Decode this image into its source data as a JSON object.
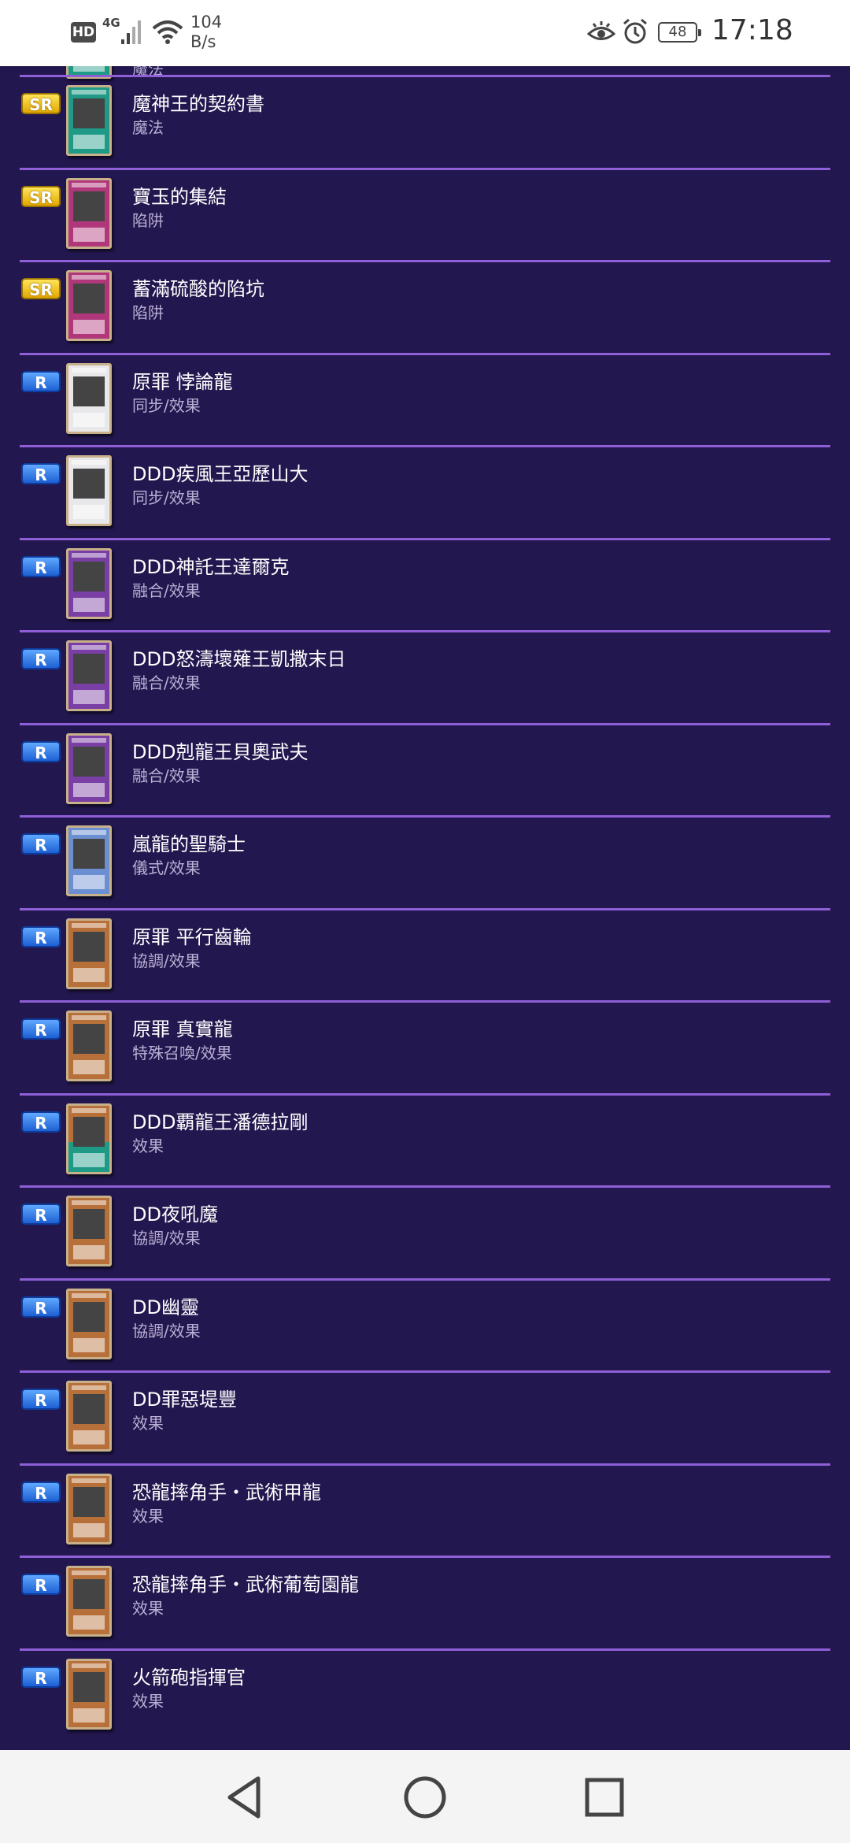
{
  "status_bar": {
    "hd": "HD",
    "network": "4G",
    "speed_value": "104",
    "speed_unit": "B/s",
    "battery": "48",
    "time": "17:18"
  },
  "partial_row": {
    "type": "魔法"
  },
  "cards": [
    {
      "rarity": "SR",
      "thumb": "spell",
      "name": "魔神王的契約書",
      "type": "魔法"
    },
    {
      "rarity": "SR",
      "thumb": "trap",
      "name": "寶玉的集結",
      "type": "陷阱"
    },
    {
      "rarity": "SR",
      "thumb": "trap",
      "name": "蓄滿硫酸的陷坑",
      "type": "陷阱"
    },
    {
      "rarity": "R",
      "thumb": "synchro",
      "name": "原罪 悖論龍",
      "type": "同步/效果"
    },
    {
      "rarity": "R",
      "thumb": "synchro",
      "name": "DDD疾風王亞歷山大",
      "type": "同步/效果"
    },
    {
      "rarity": "R",
      "thumb": "fusion",
      "name": "DDD神託王達爾克",
      "type": "融合/效果"
    },
    {
      "rarity": "R",
      "thumb": "fusion",
      "name": "DDD怒濤壞薙王凱撒末日",
      "type": "融合/效果"
    },
    {
      "rarity": "R",
      "thumb": "fusion",
      "name": "DDD剋龍王貝奧武夫",
      "type": "融合/效果"
    },
    {
      "rarity": "R",
      "thumb": "ritual",
      "name": "嵐龍的聖騎士",
      "type": "儀式/效果"
    },
    {
      "rarity": "R",
      "thumb": "effect",
      "name": "原罪 平行齒輪",
      "type": "協調/效果"
    },
    {
      "rarity": "R",
      "thumb": "effect",
      "name": "原罪 真實龍",
      "type": "特殊召喚/效果"
    },
    {
      "rarity": "R",
      "thumb": "pendeffect",
      "name": "DDD覇龍王潘德拉剛",
      "type": "效果"
    },
    {
      "rarity": "R",
      "thumb": "effect",
      "name": "DD夜吼魔",
      "type": "協調/效果"
    },
    {
      "rarity": "R",
      "thumb": "effect",
      "name": "DD幽靈",
      "type": "協調/效果"
    },
    {
      "rarity": "R",
      "thumb": "effect",
      "name": "DD罪惡堤豐",
      "type": "效果"
    },
    {
      "rarity": "R",
      "thumb": "effect",
      "name": "恐龍摔角手・武術甲龍",
      "type": "效果"
    },
    {
      "rarity": "R",
      "thumb": "effect",
      "name": "恐龍摔角手・武術葡萄園龍",
      "type": "效果"
    },
    {
      "rarity": "R",
      "thumb": "effect",
      "name": "火箭砲指揮官",
      "type": "效果"
    }
  ],
  "colors": {
    "background": "#23174f",
    "divider": "#8e5fd6",
    "sr_badge": "#f2c31a",
    "r_badge": "#2f7cf0"
  },
  "nav": {
    "back_icon": "back-triangle-icon",
    "home_icon": "home-circle-icon",
    "recents_icon": "recents-square-icon"
  }
}
